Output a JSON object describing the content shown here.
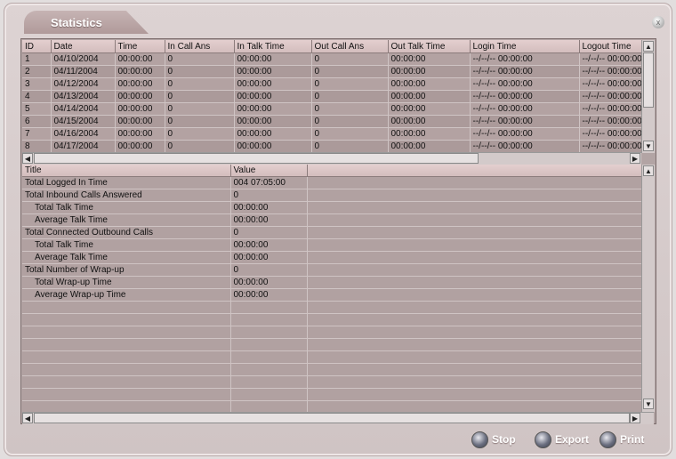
{
  "window": {
    "title": "Statistics",
    "close_label": "x"
  },
  "daily_grid": {
    "columns": [
      "ID",
      "Date",
      "Time",
      "In Call Ans",
      "In Talk Time",
      "Out Call Ans",
      "Out Talk Time",
      "Login Time",
      "Logout Time"
    ],
    "rows": [
      [
        "1",
        "04/10/2004",
        "00:00:00",
        "0",
        "00:00:00",
        "0",
        "00:00:00",
        "--/--/-- 00:00:00",
        "--/--/-- 00:00:00"
      ],
      [
        "2",
        "04/11/2004",
        "00:00:00",
        "0",
        "00:00:00",
        "0",
        "00:00:00",
        "--/--/-- 00:00:00",
        "--/--/-- 00:00:00"
      ],
      [
        "3",
        "04/12/2004",
        "00:00:00",
        "0",
        "00:00:00",
        "0",
        "00:00:00",
        "--/--/-- 00:00:00",
        "--/--/-- 00:00:00"
      ],
      [
        "4",
        "04/13/2004",
        "00:00:00",
        "0",
        "00:00:00",
        "0",
        "00:00:00",
        "--/--/-- 00:00:00",
        "--/--/-- 00:00:00"
      ],
      [
        "5",
        "04/14/2004",
        "00:00:00",
        "0",
        "00:00:00",
        "0",
        "00:00:00",
        "--/--/-- 00:00:00",
        "--/--/-- 00:00:00"
      ],
      [
        "6",
        "04/15/2004",
        "00:00:00",
        "0",
        "00:00:00",
        "0",
        "00:00:00",
        "--/--/-- 00:00:00",
        "--/--/-- 00:00:00"
      ],
      [
        "7",
        "04/16/2004",
        "00:00:00",
        "0",
        "00:00:00",
        "0",
        "00:00:00",
        "--/--/-- 00:00:00",
        "--/--/-- 00:00:00"
      ],
      [
        "8",
        "04/17/2004",
        "00:00:00",
        "0",
        "00:00:00",
        "0",
        "00:00:00",
        "--/--/-- 00:00:00",
        "--/--/-- 00:00:00"
      ]
    ]
  },
  "summary_grid": {
    "columns": [
      "Title",
      "Value"
    ],
    "rows": [
      {
        "title": "Total Logged In Time",
        "value": "004 07:05:00",
        "indent": false
      },
      {
        "title": "Total Inbound Calls Answered",
        "value": "0",
        "indent": false
      },
      {
        "title": "Total Talk Time",
        "value": "00:00:00",
        "indent": true
      },
      {
        "title": "Average Talk Time",
        "value": "00:00:00",
        "indent": true
      },
      {
        "title": "Total Connected Outbound Calls",
        "value": "0",
        "indent": false
      },
      {
        "title": "Total Talk Time",
        "value": "00:00:00",
        "indent": true
      },
      {
        "title": "Average Talk Time",
        "value": "00:00:00",
        "indent": true
      },
      {
        "title": "Total Number of Wrap-up",
        "value": "0",
        "indent": false
      },
      {
        "title": "Total Wrap-up Time",
        "value": "00:00:00",
        "indent": true
      },
      {
        "title": "Average Wrap-up Time",
        "value": "00:00:00",
        "indent": true
      },
      {
        "title": "",
        "value": "",
        "indent": false
      },
      {
        "title": "",
        "value": "",
        "indent": false
      },
      {
        "title": "",
        "value": "",
        "indent": false
      },
      {
        "title": "",
        "value": "",
        "indent": false
      },
      {
        "title": "",
        "value": "",
        "indent": false
      },
      {
        "title": "",
        "value": "",
        "indent": false
      },
      {
        "title": "",
        "value": "",
        "indent": false
      },
      {
        "title": "",
        "value": "",
        "indent": false
      },
      {
        "title": "",
        "value": "",
        "indent": false
      },
      {
        "title": "",
        "value": "",
        "indent": false
      }
    ]
  },
  "actions": {
    "stop": "Stop",
    "export": "Export",
    "print": "Print"
  },
  "scroll_icons": {
    "up": "▲",
    "down": "▼",
    "left": "◀",
    "right": "▶"
  }
}
